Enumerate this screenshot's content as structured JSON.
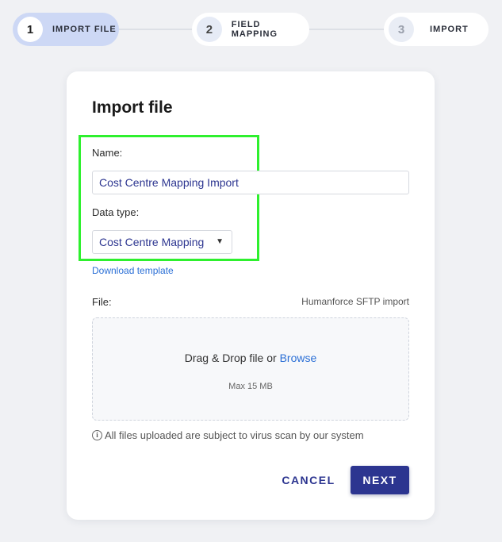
{
  "stepper": {
    "steps": [
      {
        "number": "1",
        "label": "IMPORT FILE",
        "state": "active"
      },
      {
        "number": "2",
        "label": "FIELD MAPPING",
        "state": "upcoming"
      },
      {
        "number": "3",
        "label": "IMPORT",
        "state": "pending"
      }
    ]
  },
  "form": {
    "title": "Import file",
    "name_label": "Name:",
    "name_value": "Cost Centre Mapping Import",
    "data_type_label": "Data type:",
    "data_type_value": "Cost Centre Mapping",
    "data_type_caret": "▼",
    "download_link": "Download template",
    "file_label": "File:",
    "file_source_note": "Humanforce SFTP import",
    "dropzone": {
      "prefix": "Drag & Drop file or ",
      "browse": "Browse",
      "max_size": "Max 15 MB"
    },
    "info_icon": "i",
    "scan_note": "All files uploaded are subject to virus scan by our system",
    "cancel_label": "CANCEL",
    "next_label": "NEXT"
  },
  "colors": {
    "accent": "#2c3590",
    "link": "#2b6fd6",
    "highlight": "#2ef02e",
    "active_step": "#cdd8f5"
  }
}
